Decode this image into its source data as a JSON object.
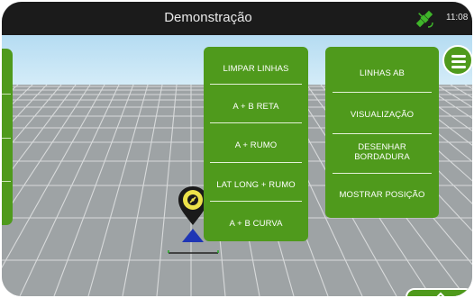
{
  "topbar": {
    "title": "Demonstração",
    "time": "11:08",
    "gps_status_icon": "satellite-icon"
  },
  "colors": {
    "accent": "#4f9a1c",
    "topbar": "#1b1b1b",
    "sky": "#c4e4f5",
    "ground": "#9ea3a5",
    "marker": "#ede34a"
  },
  "line_menu": {
    "items": [
      "LIMPAR LINHAS",
      "A + B RETA",
      "A + RUMO",
      "LAT LONG + RUMO",
      "A + B CURVA"
    ]
  },
  "main_menu": {
    "items": [
      "LINHAS AB",
      "VISUALIZAÇÃO",
      "DESENHAR\nBORDADURA",
      "MOSTRAR POSIÇÃO"
    ]
  },
  "icons": {
    "menu": "hamburger-menu-icon",
    "location": "location-pin-icon",
    "expand": "chevron-up-icon"
  }
}
